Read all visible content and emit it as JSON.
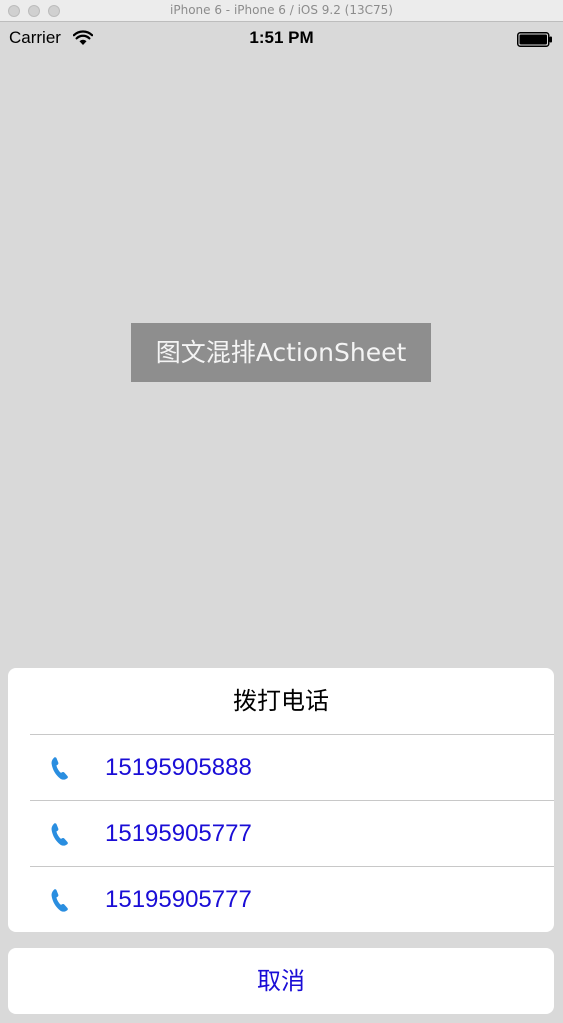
{
  "window": {
    "title": "iPhone 6 - iPhone 6 / iOS 9.2 (13C75)"
  },
  "status_bar": {
    "carrier": "Carrier",
    "time": "1:51 PM",
    "wifi_icon": "wifi-icon",
    "battery_icon": "battery-icon"
  },
  "main": {
    "button_label": "图文混排ActionSheet"
  },
  "action_sheet": {
    "title": "拨打电话",
    "items": [
      {
        "icon": "phone-icon",
        "label": "15195905888"
      },
      {
        "icon": "phone-icon",
        "label": "15195905777"
      },
      {
        "icon": "phone-icon",
        "label": "15195905777"
      }
    ],
    "cancel_label": "取消"
  },
  "colors": {
    "background": "#d9d9d9",
    "button_bg": "#8e8e8e",
    "link": "#1a0dd6",
    "icon": "#2a8ee0"
  }
}
